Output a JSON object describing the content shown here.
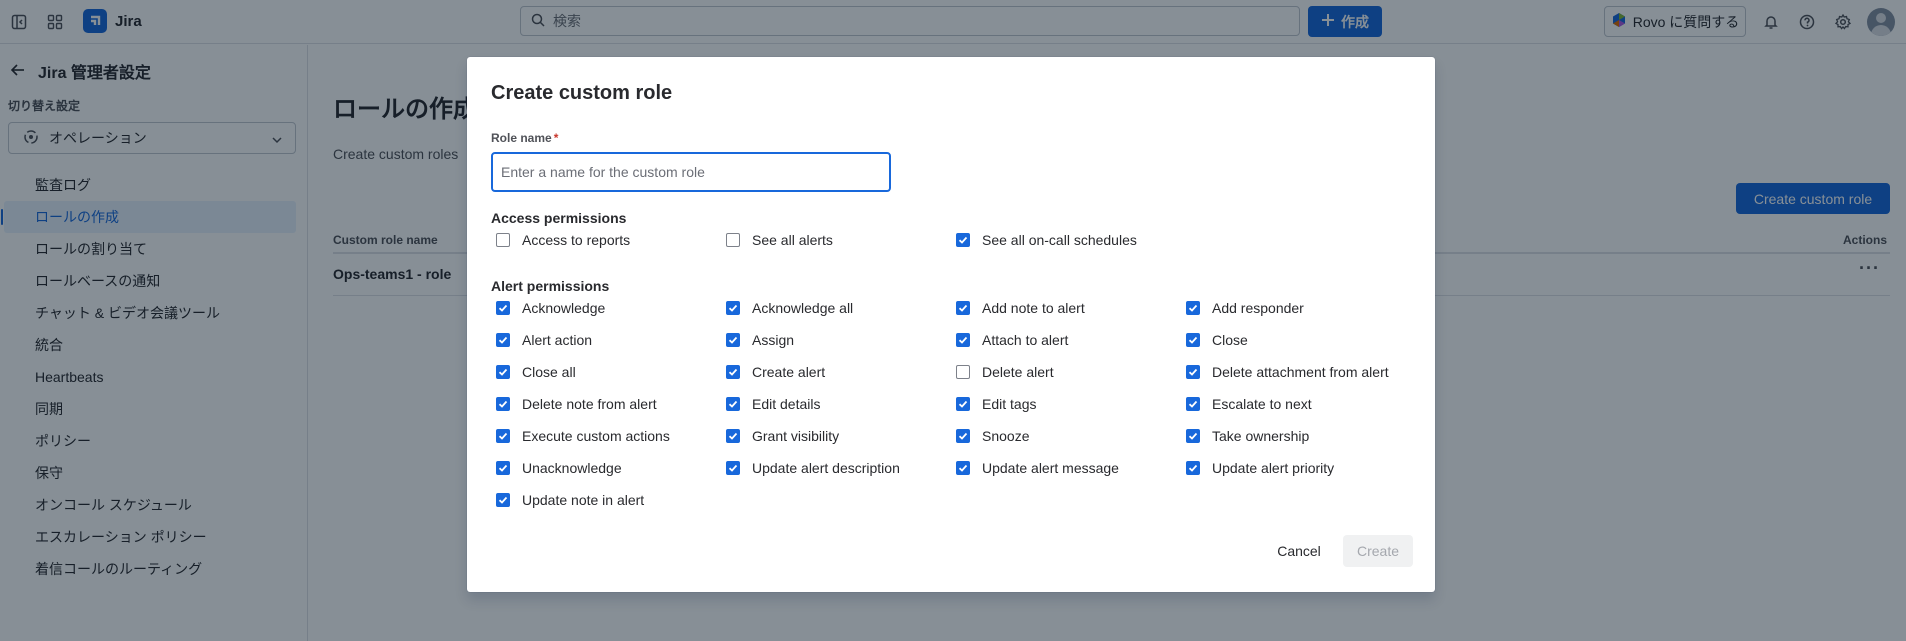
{
  "topbar": {
    "app_name": "Jira",
    "search_placeholder": "検索",
    "create_label": "作成",
    "rovo_label": "Rovo に質問する"
  },
  "sidebar": {
    "title": "Jira 管理者設定",
    "switch_label": "切り替え設定",
    "project": "オペレーション",
    "items": [
      {
        "label": "監査ログ",
        "active": false
      },
      {
        "label": "ロールの作成",
        "active": true
      },
      {
        "label": "ロールの割り当て",
        "active": false
      },
      {
        "label": "ロールベースの通知",
        "active": false
      },
      {
        "label": "チャット & ビデオ会議ツール",
        "active": false
      },
      {
        "label": "統合",
        "active": false
      },
      {
        "label": "Heartbeats",
        "active": false
      },
      {
        "label": "同期",
        "active": false
      },
      {
        "label": "ポリシー",
        "active": false
      },
      {
        "label": "保守",
        "active": false
      },
      {
        "label": "オンコール スケジュール",
        "active": false
      },
      {
        "label": "エスカレーション ポリシー",
        "active": false
      },
      {
        "label": "着信コールのルーティング",
        "active": false
      }
    ]
  },
  "main": {
    "title": "ロールの作成",
    "description": "Create custom roles",
    "create_button": "Create custom role",
    "table": {
      "col_name": "Custom role name",
      "col_actions": "Actions",
      "rows": [
        {
          "name": "Ops-teams1 - role"
        }
      ]
    }
  },
  "modal": {
    "title": "Create custom role",
    "role_name_label": "Role name",
    "required_mark": "*",
    "role_name_value": "",
    "role_name_placeholder": "Enter a name for the custom role",
    "access_title": "Access permissions",
    "access_permissions": [
      {
        "label": "Access to reports",
        "checked": false
      },
      {
        "label": "See all alerts",
        "checked": false
      },
      {
        "label": "See all on-call schedules",
        "checked": true
      }
    ],
    "alert_title": "Alert permissions",
    "alert_permissions": [
      {
        "label": "Acknowledge",
        "checked": true
      },
      {
        "label": "Acknowledge all",
        "checked": true
      },
      {
        "label": "Add note to alert",
        "checked": true
      },
      {
        "label": "Add responder",
        "checked": true
      },
      {
        "label": "Alert action",
        "checked": true
      },
      {
        "label": "Assign",
        "checked": true
      },
      {
        "label": "Attach to alert",
        "checked": true
      },
      {
        "label": "Close",
        "checked": true
      },
      {
        "label": "Close all",
        "checked": true
      },
      {
        "label": "Create alert",
        "checked": true
      },
      {
        "label": "Delete alert",
        "checked": false
      },
      {
        "label": "Delete attachment from alert",
        "checked": true
      },
      {
        "label": "Delete note from alert",
        "checked": true
      },
      {
        "label": "Edit details",
        "checked": true
      },
      {
        "label": "Edit tags",
        "checked": true
      },
      {
        "label": "Escalate to next",
        "checked": true
      },
      {
        "label": "Execute custom actions",
        "checked": true
      },
      {
        "label": "Grant visibility",
        "checked": true
      },
      {
        "label": "Snooze",
        "checked": true
      },
      {
        "label": "Take ownership",
        "checked": true
      },
      {
        "label": "Unacknowledge",
        "checked": true
      },
      {
        "label": "Update alert description",
        "checked": true
      },
      {
        "label": "Update alert message",
        "checked": true
      },
      {
        "label": "Update alert priority",
        "checked": true
      },
      {
        "label": "Update note in alert",
        "checked": true
      }
    ],
    "cancel_label": "Cancel",
    "create_label": "Create"
  },
  "colors": {
    "primary": "#1868DB",
    "overlay": "#051524",
    "required": "#C9372C"
  }
}
